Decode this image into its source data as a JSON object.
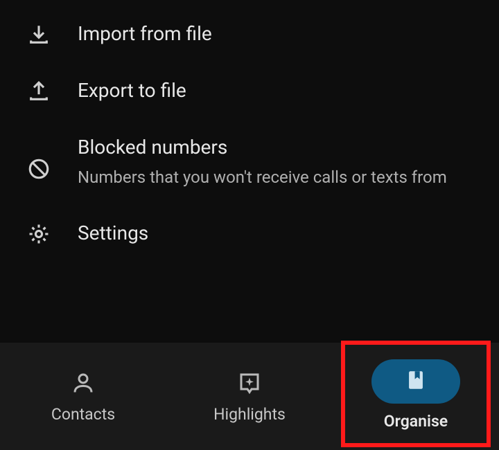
{
  "menu": {
    "import": {
      "label": "Import from file"
    },
    "export": {
      "label": "Export to file"
    },
    "blocked": {
      "label": "Blocked numbers",
      "sub": "Numbers that you won't receive calls or texts from"
    },
    "settings": {
      "label": "Settings"
    }
  },
  "nav": {
    "contacts": {
      "label": "Contacts"
    },
    "highlights": {
      "label": "Highlights"
    },
    "organise": {
      "label": "Organise"
    }
  }
}
